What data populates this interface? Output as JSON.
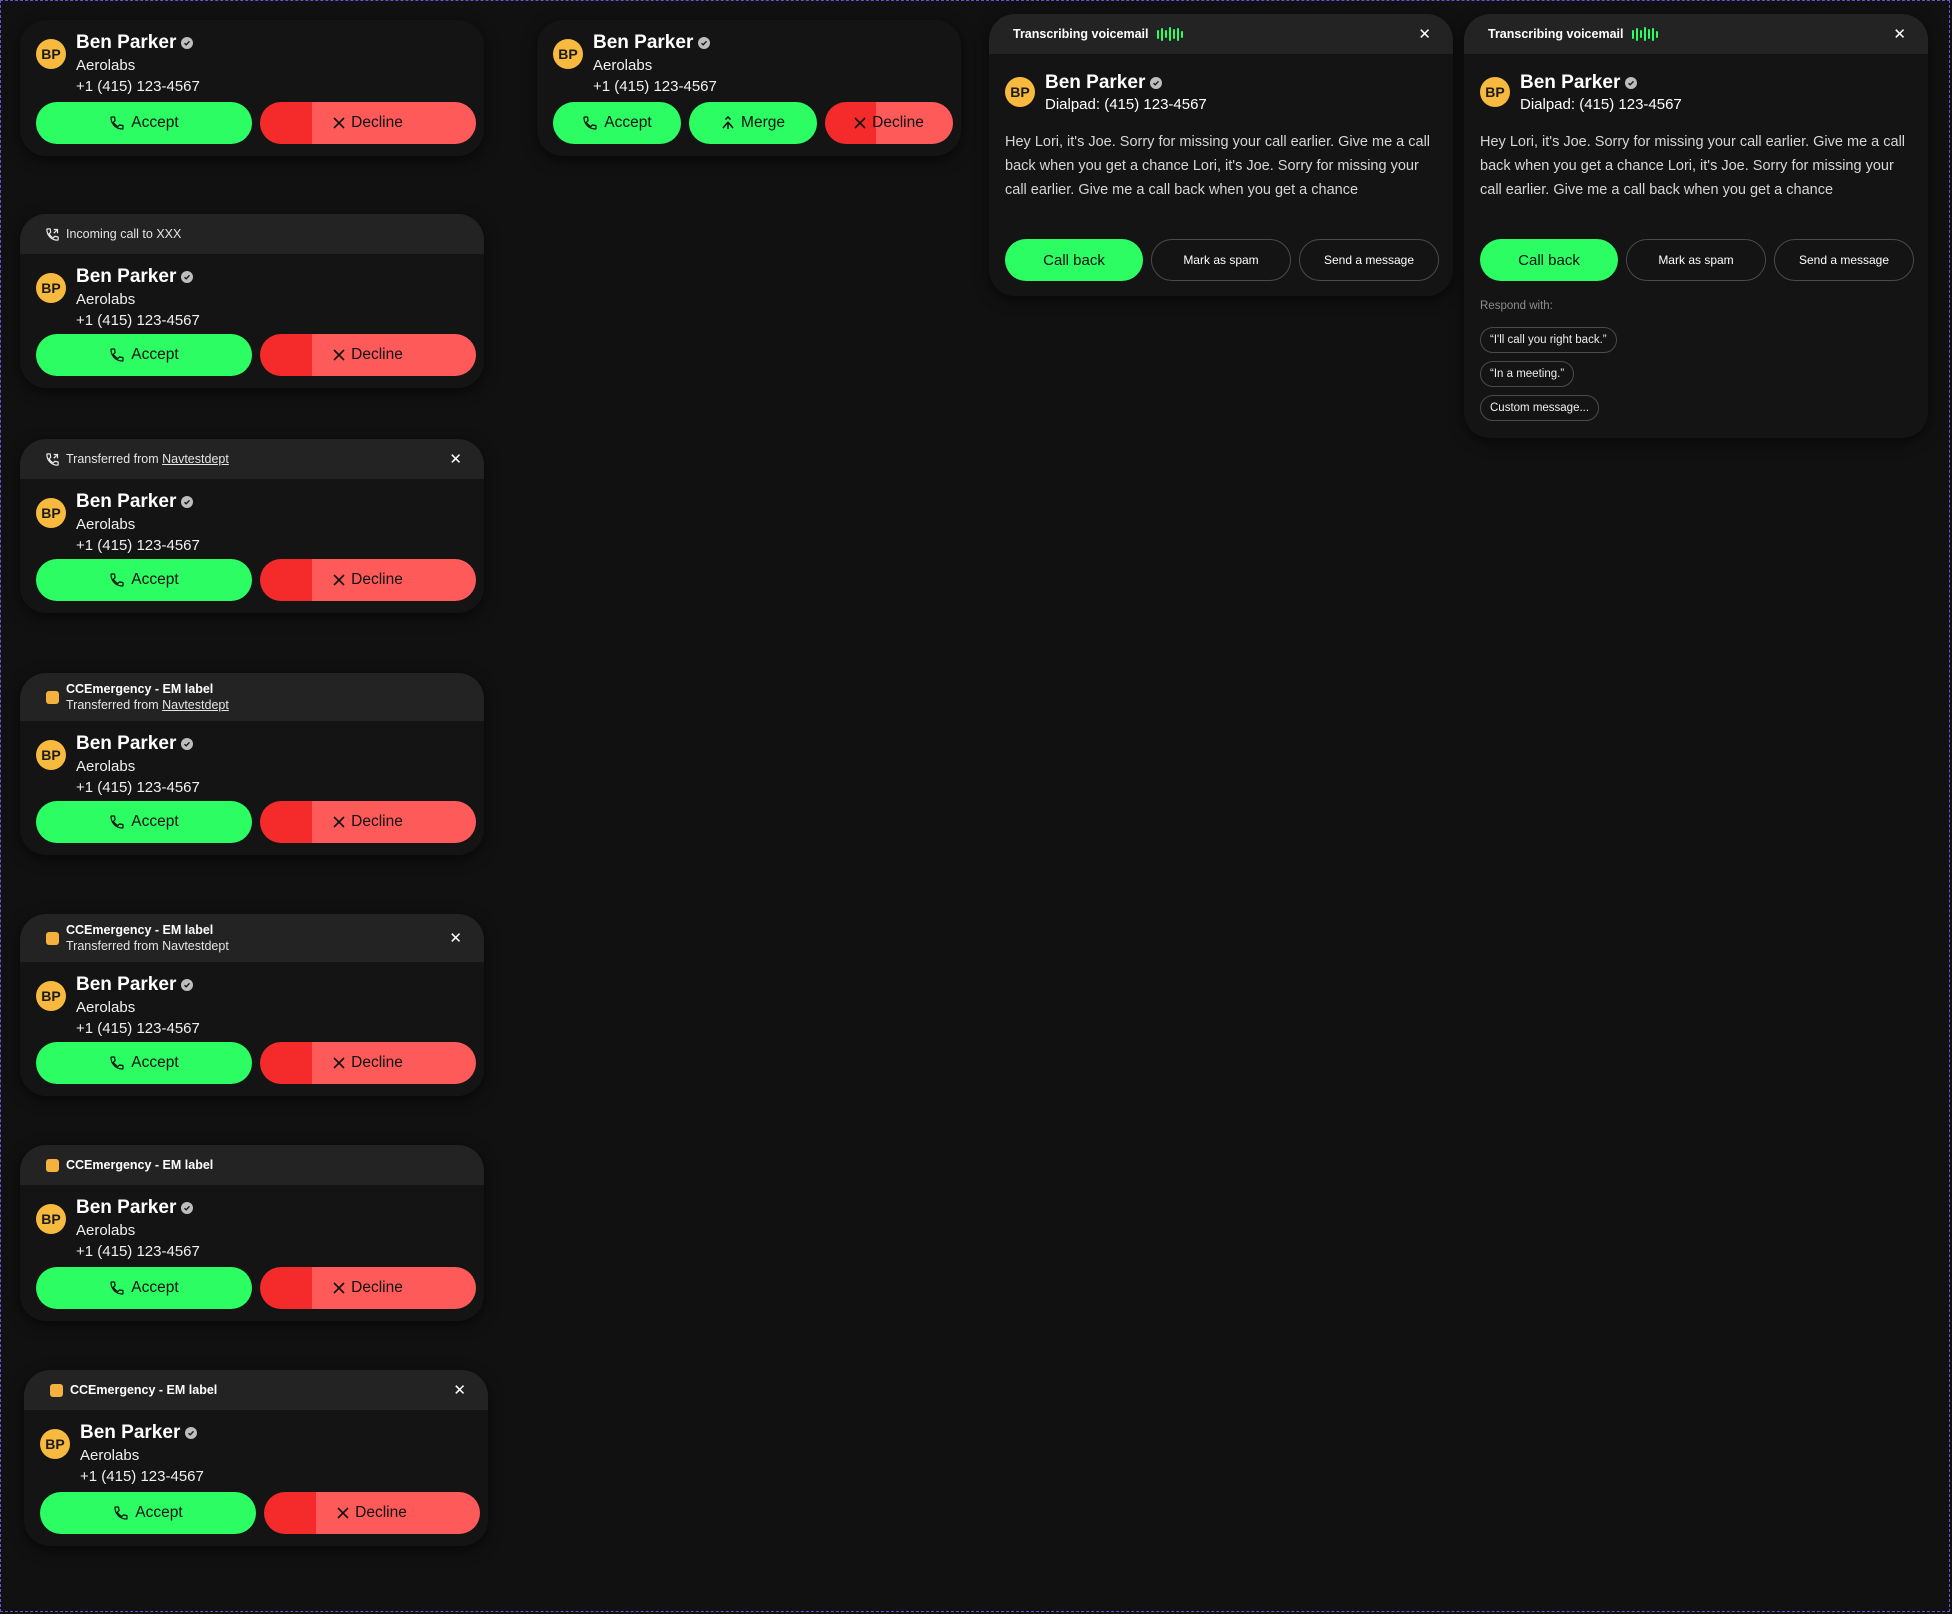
{
  "contact": {
    "initials": "BP",
    "name": "Ben Parker",
    "company": "Aerolabs",
    "phone": "+1 (415) 123-4567",
    "dialpad_phone": "Dialpad: (415) 123-4567"
  },
  "actions": {
    "accept": "Accept",
    "decline": "Decline",
    "merge": "Merge"
  },
  "headers": {
    "incoming": "Incoming call to XXX",
    "transferred_prefix": "Transferred from",
    "transferred_dept": "Navtestdept",
    "transferred_full": "Transferred from Navtestdept",
    "emergency": "CCEmergency - EM label",
    "voicemail": "Transcribing voicemail"
  },
  "voicemail": {
    "transcript": "Hey Lori, it's Joe. Sorry for missing your call earlier. Give me a call back when you get a chance Lori, it's Joe. Sorry for missing your call earlier. Give me a call back when you get a chance",
    "call_back": "Call back",
    "mark_spam": "Mark as spam",
    "send_message": "Send a message",
    "respond_with": "Respond with:",
    "responses": [
      "“I'll call you right back.”",
      "“In a meeting.”",
      "Custom message..."
    ]
  },
  "icons": {
    "phone": "phone-icon",
    "close": "close-icon",
    "merge": "merge-icon",
    "transfer": "call-transfer-icon",
    "verified": "verified-badge-icon",
    "emergency": "emergency-label-icon",
    "waveform": "waveform-icon"
  },
  "colors": {
    "background": "#111111",
    "card": "#141414",
    "header": "#232323",
    "accept": "#2bfd63",
    "decline": "#ff5a5a",
    "decline_dark": "#f52a2a",
    "avatar": "#f7b93e",
    "emergency": "#f5b13d"
  }
}
